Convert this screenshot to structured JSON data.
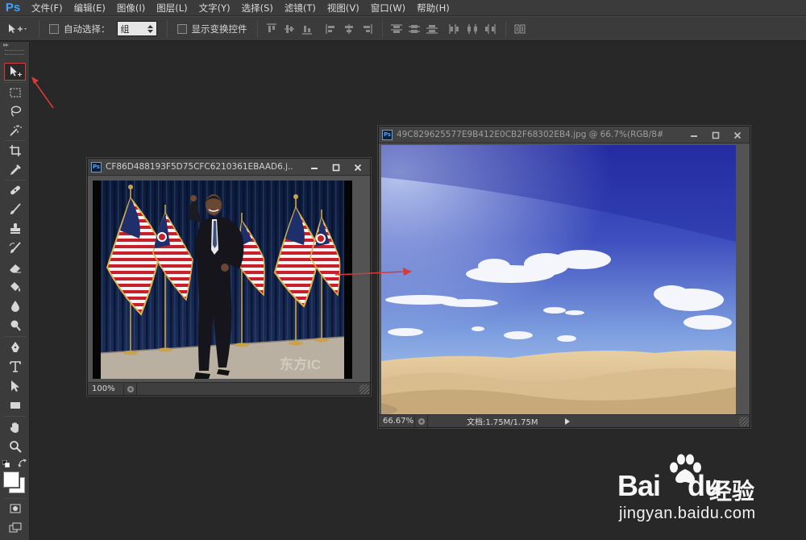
{
  "app": {
    "logo": "Ps",
    "accent_color": "#3fa1ff",
    "annotation_color": "#d63a3a"
  },
  "menu": {
    "items": [
      "文件(F)",
      "编辑(E)",
      "图像(I)",
      "图层(L)",
      "文字(Y)",
      "选择(S)",
      "滤镜(T)",
      "视图(V)",
      "窗口(W)",
      "帮助(H)"
    ]
  },
  "options_bar": {
    "tool_icon": "move-tool-icon",
    "auto_select_label": "自动选择：",
    "auto_select_checked": false,
    "auto_select_value": "组",
    "show_transform_label": "显示变换控件",
    "show_transform_checked": false
  },
  "tools": {
    "active": "move-tool",
    "list": [
      "move-tool",
      "marquee-tool",
      "lasso-tool",
      "magic-wand-tool",
      "crop-tool",
      "eyedropper-tool",
      "healing-brush-tool",
      "brush-tool",
      "clone-stamp-tool",
      "history-brush-tool",
      "eraser-tool",
      "paint-bucket-tool",
      "blur-tool",
      "dodge-tool",
      "pen-tool",
      "type-tool",
      "path-selection-tool",
      "rectangle-tool",
      "hand-tool",
      "zoom-tool"
    ]
  },
  "documents": [
    {
      "title": "CF86D488193F5D75CFC6210361EBAAD6.j...",
      "zoom": "100%",
      "active": true,
      "photo_watermark": "东方IC"
    },
    {
      "title": "49C829625577E9B412E0CB2F68302EB4.jpg @ 66.7%(RGB/8#)",
      "zoom": "66.67%",
      "doc_info": "文档:1.75M/1.75M",
      "active": false
    }
  ],
  "watermark": {
    "brand_latin": "Bai",
    "brand_latin2": "du",
    "brand_cn": "经验",
    "url": "jingyan.baidu.com"
  }
}
